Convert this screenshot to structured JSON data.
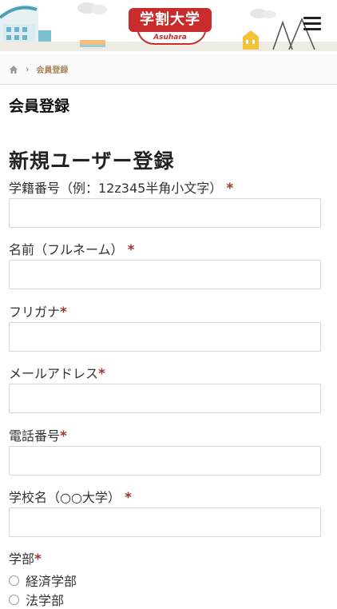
{
  "header": {
    "logo_text": "学割大学",
    "logo_sub": "Asuhara",
    "menu_icon": "hamburger-menu-icon"
  },
  "breadcrumb": {
    "home_icon": "home-icon",
    "separator": "›",
    "current": "会員登録"
  },
  "page_title": "会員登録",
  "form": {
    "title": "新規ユーザー登録",
    "required_mark": "*",
    "fields": [
      {
        "label": "学籍番号（例：12z345半角小文字）",
        "value": "",
        "placeholder": ""
      },
      {
        "label": "名前（フルネーム）",
        "value": "",
        "placeholder": ""
      },
      {
        "label": "フリガナ",
        "value": "",
        "placeholder": ""
      },
      {
        "label": "メールアドレス",
        "value": "",
        "placeholder": ""
      },
      {
        "label": "電話番号",
        "value": "",
        "placeholder": ""
      },
      {
        "label": "学校名（○○大学）",
        "value": "",
        "placeholder": ""
      }
    ],
    "faculty": {
      "label": "学部",
      "options": [
        "経済学部",
        "法学部"
      ]
    }
  },
  "colors": {
    "accent_red": "#c82c2c",
    "required_red": "#a0342e",
    "breadcrumb_gold": "#a9875b"
  }
}
